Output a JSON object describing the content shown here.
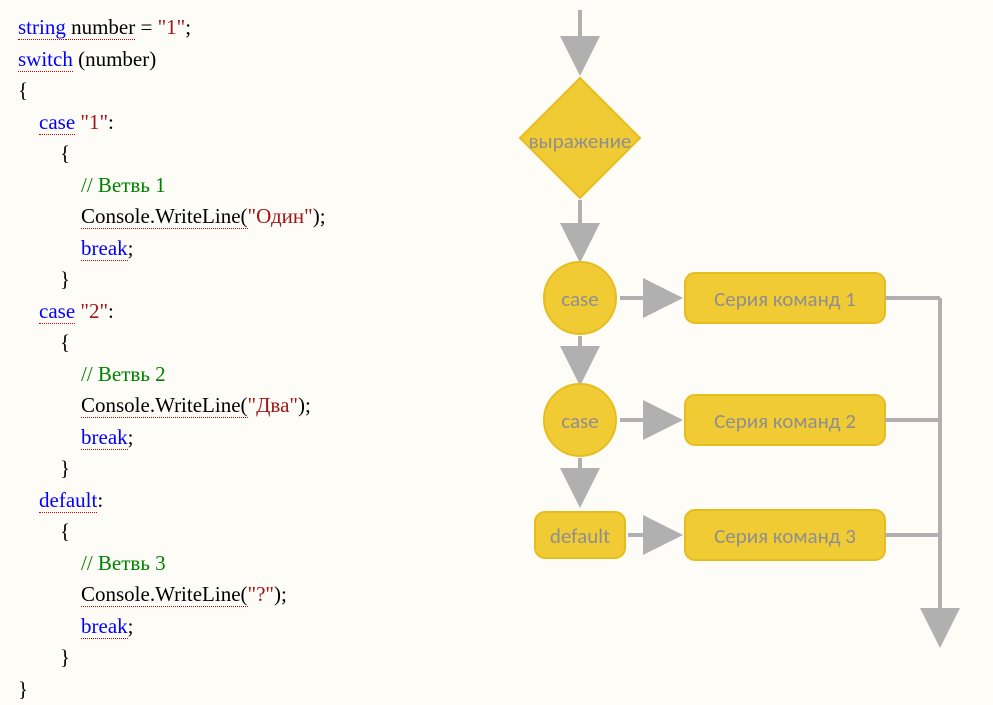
{
  "code": {
    "l1_kw": "string",
    "l1_ident": " number",
    "l1_rest": " = ",
    "l1_str": "\"1\"",
    "l1_semi": ";",
    "l2_kw": "switch",
    "l2_rest": " (number)",
    "l3": "{",
    "l4_kw": "case",
    "l4_str": " \"1\"",
    "l4_colon": ":",
    "l5": "        {",
    "l6_comment": "            // Ветвь 1",
    "l7_prefix": "            ",
    "l7_method": "Console.WriteLine(",
    "l7_str": "\"Один\"",
    "l7_close": ");",
    "l8_prefix": "            ",
    "l8_kw": "break",
    "l8_semi": ";",
    "l9": "        }",
    "l10_kw": "case",
    "l10_str": " \"2\"",
    "l10_colon": ":",
    "l11": "        {",
    "l12_comment": "            // Ветвь 2",
    "l13_prefix": "            ",
    "l13_method": "Console.WriteLine(",
    "l13_str": "\"Два\"",
    "l13_close": ");",
    "l14_prefix": "            ",
    "l14_kw": "break",
    "l14_semi": ";",
    "l15": "        }",
    "l16_kw": "default",
    "l16_colon": ":",
    "l17": "        {",
    "l18_comment": "            // Ветвь 3",
    "l19_prefix": "            ",
    "l19_method": "Console.WriteLine(",
    "l19_str": "\"?\"",
    "l19_close": ");",
    "l20_prefix": "            ",
    "l20_kw": "break",
    "l20_semi": ";",
    "l21": "        }",
    "l22": "}"
  },
  "diagram": {
    "expression": "выражение",
    "case1": "case",
    "case2": "case",
    "default": "default",
    "series1": "Серия команд 1",
    "series2": "Серия команд 2",
    "series3": "Серия команд 3"
  }
}
